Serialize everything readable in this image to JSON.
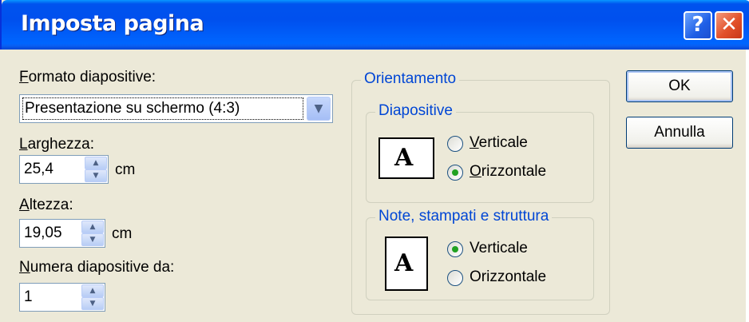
{
  "window": {
    "title": "Imposta pagina",
    "help_glyph": "?",
    "close_glyph": "✕"
  },
  "left": {
    "format_label": "Formato diapositive:",
    "format_value": "Presentazione su schermo (4:3)",
    "width_label": "Larghezza:",
    "width_value": "25,4",
    "width_unit": "cm",
    "height_label": "Altezza:",
    "height_value": "19,05",
    "height_unit": "cm",
    "number_label": "Numera diapositive da:",
    "number_value": "1"
  },
  "orientation": {
    "title": "Orientamento",
    "slides_group": "Diapositive",
    "slides_options": [
      "Verticale",
      "Orizzontale"
    ],
    "slides_selected": "Orizzontale",
    "notes_group": "Note, stampati e struttura",
    "notes_options": [
      "Verticale",
      "Orizzontale"
    ],
    "notes_selected": "Verticale",
    "page_glyph": "A"
  },
  "buttons": {
    "ok": "OK",
    "cancel": "Annulla"
  }
}
